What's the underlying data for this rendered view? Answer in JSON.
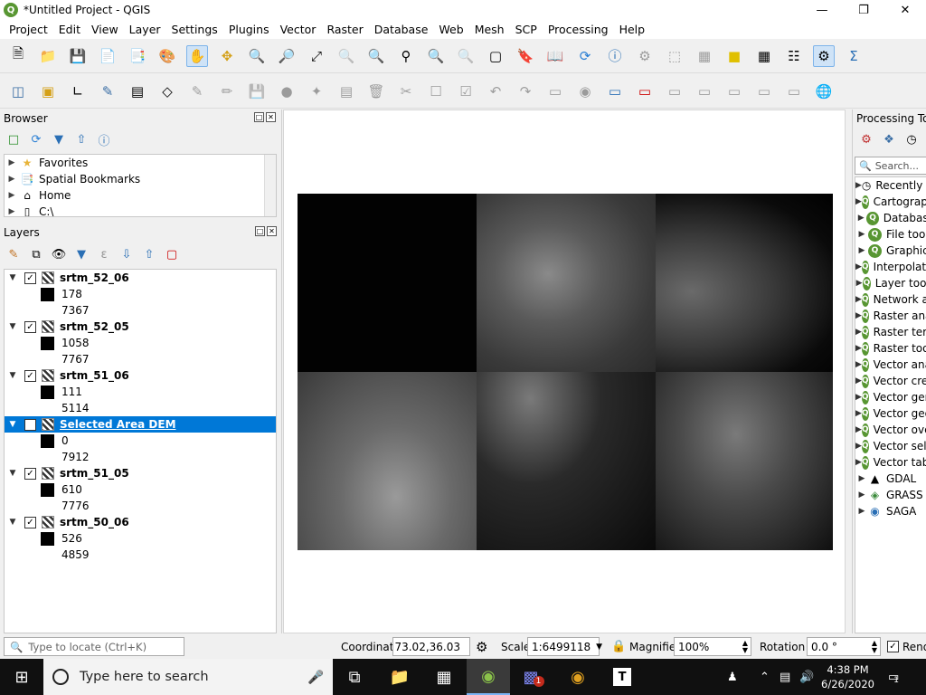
{
  "window": {
    "title": "*Untitled Project - QGIS",
    "logo": "Q"
  },
  "menubar": [
    "Project",
    "Edit",
    "View",
    "Layer",
    "Settings",
    "Plugins",
    "Vector",
    "Raster",
    "Database",
    "Web",
    "Mesh",
    "SCP",
    "Processing",
    "Help"
  ],
  "browser": {
    "title": "Browser",
    "items": [
      {
        "label": "Favorites",
        "icon": "star-icon"
      },
      {
        "label": "Spatial Bookmarks",
        "icon": "bookmark-icon"
      },
      {
        "label": "Home",
        "icon": "home-icon"
      },
      {
        "label": "C:\\",
        "icon": "drive-icon"
      }
    ]
  },
  "layers": {
    "title": "Layers",
    "items": [
      {
        "name": "srtm_52_06",
        "min": "178",
        "max": "7367"
      },
      {
        "name": "srtm_52_05",
        "min": "1058",
        "max": "7767"
      },
      {
        "name": "srtm_51_06",
        "min": "111",
        "max": "5114"
      },
      {
        "name": "Selected Area DEM",
        "min": "0",
        "max": "7912",
        "selected": true
      },
      {
        "name": "srtm_51_05",
        "min": "610",
        "max": "7776"
      },
      {
        "name": "srtm_50_06",
        "min": "526",
        "max": "4859"
      }
    ]
  },
  "processing": {
    "title": "Processing Toolbox",
    "search_placeholder": "Search...",
    "items": [
      {
        "label": "Recently used",
        "icon": "clock-icon"
      },
      {
        "label": "Cartography",
        "icon": "qgis-icon"
      },
      {
        "label": "Database",
        "icon": "qgis-icon"
      },
      {
        "label": "File tools",
        "icon": "qgis-icon"
      },
      {
        "label": "Graphics",
        "icon": "qgis-icon"
      },
      {
        "label": "Interpolation",
        "icon": "qgis-icon"
      },
      {
        "label": "Layer tools",
        "icon": "qgis-icon"
      },
      {
        "label": "Network analysis",
        "icon": "qgis-icon"
      },
      {
        "label": "Raster analysis",
        "icon": "qgis-icon"
      },
      {
        "label": "Raster terrain analysis",
        "icon": "qgis-icon"
      },
      {
        "label": "Raster tools",
        "icon": "qgis-icon"
      },
      {
        "label": "Vector analysis",
        "icon": "qgis-icon"
      },
      {
        "label": "Vector creation",
        "icon": "qgis-icon"
      },
      {
        "label": "Vector general",
        "icon": "qgis-icon"
      },
      {
        "label": "Vector geometry",
        "icon": "qgis-icon"
      },
      {
        "label": "Vector overlay",
        "icon": "qgis-icon"
      },
      {
        "label": "Vector selection",
        "icon": "qgis-icon"
      },
      {
        "label": "Vector table",
        "icon": "qgis-icon"
      },
      {
        "label": "GDAL",
        "icon": "gdal-icon"
      },
      {
        "label": "GRASS",
        "icon": "grass-icon"
      },
      {
        "label": "SAGA",
        "icon": "saga-icon"
      }
    ]
  },
  "statusbar": {
    "locate_placeholder": "Type to locate (Ctrl+K)",
    "coordinate_label": "Coordinate",
    "coordinate_value": "73.02,36.03",
    "scale_label": "Scale",
    "scale_value": "1:6499118",
    "magnifier_label": "Magnifier",
    "magnifier_value": "100%",
    "rotation_label": "Rotation",
    "rotation_value": "0.0 °",
    "render_label": "Render"
  },
  "taskbar": {
    "search_placeholder": "Type here to search",
    "time": "4:38 PM",
    "date": "6/26/2020",
    "notification_count": "1",
    "teams_badge": "1"
  },
  "colors": {
    "selection": "#0078d7",
    "qgis_green": "#589632"
  }
}
